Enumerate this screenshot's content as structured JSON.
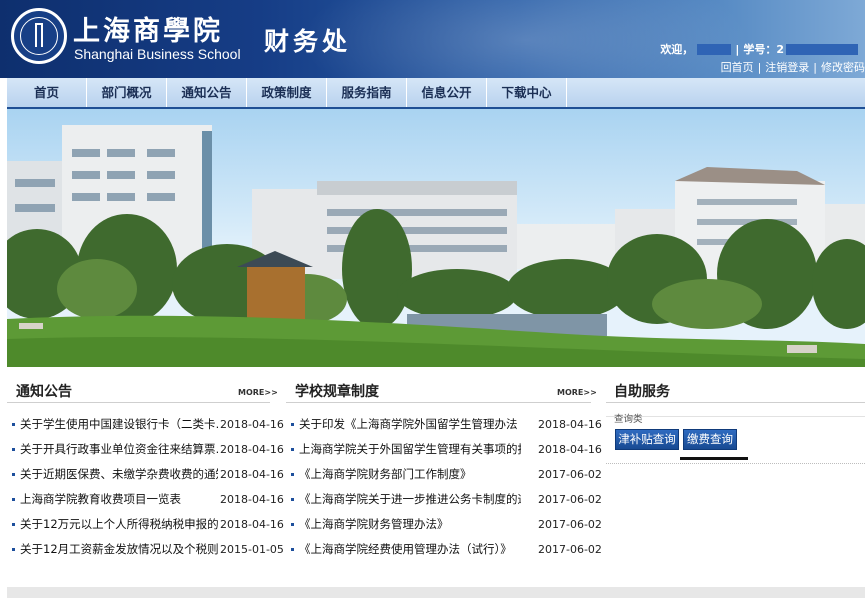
{
  "header": {
    "school_cn": "上海商學院",
    "school_en": "Shanghai Business School",
    "dept": "财务处",
    "welcome": "欢迎，",
    "student_no": "学号：2",
    "links": [
      "回首页",
      "注销登录",
      "修改密码"
    ]
  },
  "nav": [
    "首页",
    "部门概况",
    "通知公告",
    "政策制度",
    "服务指南",
    "信息公开",
    "下载中心"
  ],
  "notices": {
    "title": "通知公告",
    "more": "MORE>>",
    "items": [
      {
        "title": "关于学生使用中国建设银行卡（二类卡…",
        "date": "2018-04-16"
      },
      {
        "title": "关于开具行政事业单位资金往来结算票…",
        "date": "2018-04-16"
      },
      {
        "title": "关于近期医保费、未缴学杂费收费的通知",
        "date": "2018-04-16"
      },
      {
        "title": "上海商学院教育收费项目一览表",
        "date": "2018-04-16"
      },
      {
        "title": "关于12万元以上个人所得税纳税申报的…",
        "date": "2018-04-16"
      },
      {
        "title": "关于12月工资薪金发放情况以及个税则…",
        "date": "2015-01-05"
      }
    ]
  },
  "rules": {
    "title": "学校规章制度",
    "more": "MORE>>",
    "items": [
      {
        "title": "关于印发《上海商学院外国留学生管理办法（…",
        "date": "2018-04-16"
      },
      {
        "title": "上海商学院关于外国留学生管理有关事项的报告",
        "date": "2018-04-16"
      },
      {
        "title": "《上海商学院财务部门工作制度》",
        "date": "2017-06-02"
      },
      {
        "title": "《上海商学院关于进一步推进公务卡制度的通…",
        "date": "2017-06-02"
      },
      {
        "title": "《上海商学院财务管理办法》",
        "date": "2017-06-02"
      },
      {
        "title": "《上海商学院经费使用管理办法（试行）》",
        "date": "2017-06-02"
      }
    ]
  },
  "services": {
    "title": "自助服务",
    "subtitle": "查询类",
    "buttons": [
      "津补贴查询",
      "缴费查询"
    ]
  },
  "colors": {
    "header_dark": "#0e2f6e",
    "nav_bg": "#c6dbf2",
    "accent": "#1d4f9c"
  }
}
